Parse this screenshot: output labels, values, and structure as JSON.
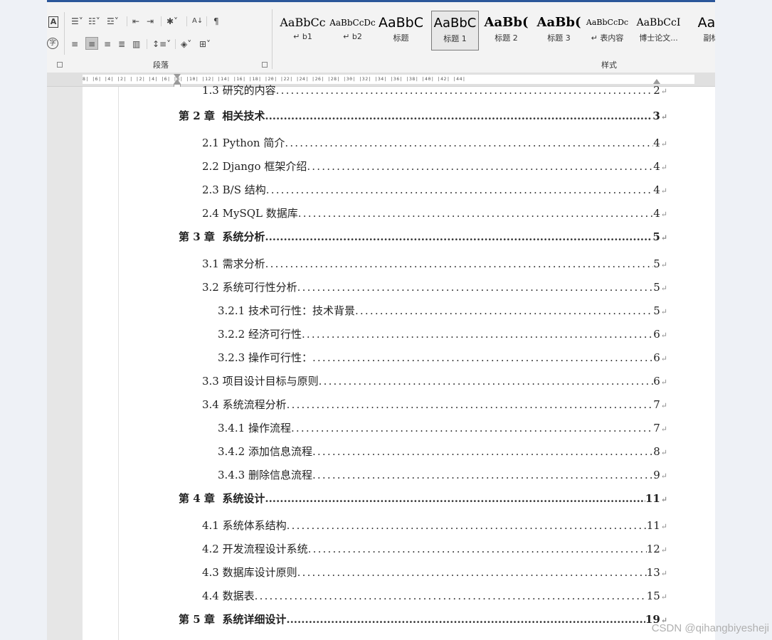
{
  "ribbon": {
    "paragraph_group_label": "段落",
    "styles_group_label": "样式",
    "styles": [
      {
        "sample": "AaBbCc",
        "name": "↵ b1",
        "weight": "normal",
        "size": 16
      },
      {
        "sample": "AaBbCcDc",
        "name": "↵ b2",
        "weight": "normal",
        "size": 12
      },
      {
        "sample": "AaBbC",
        "name": "标题",
        "weight": "normal",
        "size": 19
      },
      {
        "sample": "AaBbC",
        "name": "标题 1",
        "weight": "normal",
        "size": 18,
        "selected": true
      },
      {
        "sample": "AaBb(",
        "name": "标题 2",
        "weight": "bold",
        "size": 18
      },
      {
        "sample": "AaBb(",
        "name": "标题 3",
        "weight": "bold",
        "size": 18
      },
      {
        "sample": "AaBbCcDc",
        "name": "↵ 表内容",
        "weight": "normal",
        "size": 11
      },
      {
        "sample": "AaBbCcI",
        "name": "博士论文...",
        "weight": "normal",
        "size": 14
      },
      {
        "sample": "AaB",
        "name": "副标",
        "weight": "normal",
        "size": 19
      }
    ]
  },
  "ruler": {
    "numbers": "8| |6| |4| |2| | |2| |4| |6| |8| |10| |12| |14| |16| |18| |20| |22| |24| |26| |28| |30| |32| |34| |36| |38| |40| |42| |44|"
  },
  "toc": [
    {
      "level": "l2",
      "num": "1.3",
      "title": "研究的内容",
      "page": "2",
      "partial": true
    },
    {
      "level": "ch",
      "num": "第 2 章",
      "title": "相关技术",
      "page": "3"
    },
    {
      "level": "l2",
      "num": "2.1",
      "title": "Python 简介",
      "page": "4"
    },
    {
      "level": "l2",
      "num": "2.2",
      "title": "Django 框架介绍",
      "page": "4"
    },
    {
      "level": "l2",
      "num": "2.3",
      "title": "B/S 结构",
      "page": "4"
    },
    {
      "level": "l2",
      "num": "2.4",
      "title": "MySQL 数据库",
      "page": "4"
    },
    {
      "level": "ch",
      "num": "第 3 章",
      "title": "系统分析",
      "page": "5"
    },
    {
      "level": "l2",
      "num": "3.1",
      "title": "需求分析",
      "page": "5"
    },
    {
      "level": "l2",
      "num": "3.2",
      "title": "系统可行性分析",
      "page": "5"
    },
    {
      "level": "l3",
      "num": "3.2.1",
      "title": "技术可行性：技术背景",
      "page": "5"
    },
    {
      "level": "l3",
      "num": "3.2.2",
      "title": "经济可行性",
      "page": "6"
    },
    {
      "level": "l3",
      "num": "3.2.3",
      "title": "操作可行性：",
      "page": "6"
    },
    {
      "level": "l2",
      "num": "3.3",
      "title": "项目设计目标与原则",
      "page": "6"
    },
    {
      "level": "l2",
      "num": "3.4",
      "title": "系统流程分析",
      "page": "7"
    },
    {
      "level": "l3",
      "num": "3.4.1",
      "title": "操作流程",
      "page": "7"
    },
    {
      "level": "l3",
      "num": "3.4.2",
      "title": "添加信息流程",
      "page": "8"
    },
    {
      "level": "l3",
      "num": "3.4.3",
      "title": "删除信息流程",
      "page": "9"
    },
    {
      "level": "ch",
      "num": "第 4 章",
      "title": "系统设计",
      "page": "11"
    },
    {
      "level": "l2",
      "num": "4.1",
      "title": "系统体系结构",
      "page": "11"
    },
    {
      "level": "l2",
      "num": "4.2",
      "title": "开发流程设计系统",
      "page": "12"
    },
    {
      "level": "l2",
      "num": "4.3",
      "title": "数据库设计原则",
      "page": "13"
    },
    {
      "level": "l2",
      "num": "4.4",
      "title": "数据表",
      "page": "15"
    },
    {
      "level": "ch",
      "num": "第 5 章",
      "title": "系统详细设计",
      "page": "19"
    }
  ],
  "paragraph_mark": "↵",
  "watermark": "CSDN @qihangbiyesheji"
}
